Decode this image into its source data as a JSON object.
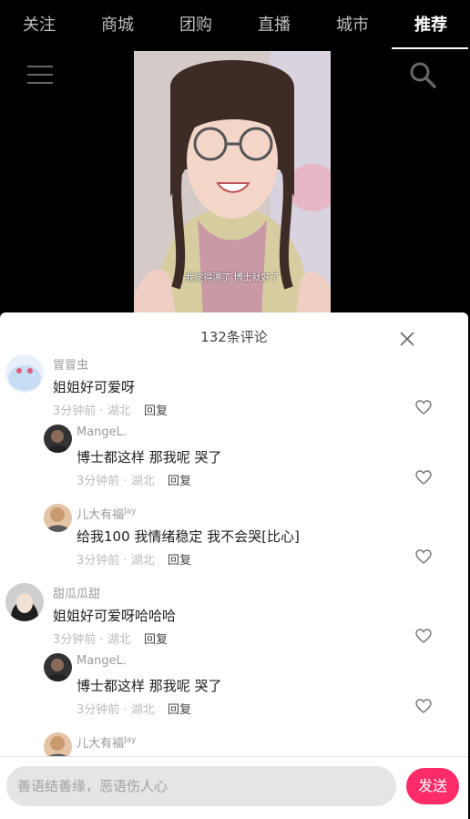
{
  "nav": {
    "tabs": [
      "关注",
      "商城",
      "团购",
      "直播",
      "城市",
      "推荐"
    ],
    "active_index": 5
  },
  "video": {
    "caption": "我觉得漂了 博士就好了"
  },
  "comments_panel": {
    "title": "132条评论",
    "comments": [
      {
        "name": "冒冒虫",
        "text": "姐姐好可爱呀",
        "time": "3分钟前 · 湖北",
        "reply": "回复",
        "level": 0
      },
      {
        "name": "MangeL.",
        "text": "博士都这样 那我呢 哭了",
        "time": "3分钟前 · 湖北",
        "reply": "回复",
        "level": 1
      },
      {
        "name": "儿大有福",
        "name_sup": "Jay",
        "text": "给我100 我情绪稳定 我不会哭[比心]",
        "time": "3分钟前 · 湖北",
        "reply": "回复",
        "level": 1
      },
      {
        "name": "甜瓜瓜甜",
        "text": "姐姐好可爱呀哈哈哈",
        "time": "3分钟前 · 湖北",
        "reply": "回复",
        "level": 0
      },
      {
        "name": "MangeL.",
        "text": "博士都这样 那我呢 哭了",
        "time": "3分钟前 · 湖北",
        "reply": "回复",
        "level": 1
      },
      {
        "name": "儿大有福",
        "name_sup": "Jay",
        "level": 1
      }
    ]
  },
  "input": {
    "placeholder": "善语结善缘，恶语伤人心",
    "send_label": "发送"
  },
  "colors": {
    "accent": "#fd2c68",
    "background": "#000000",
    "sheet": "#ffffff"
  }
}
